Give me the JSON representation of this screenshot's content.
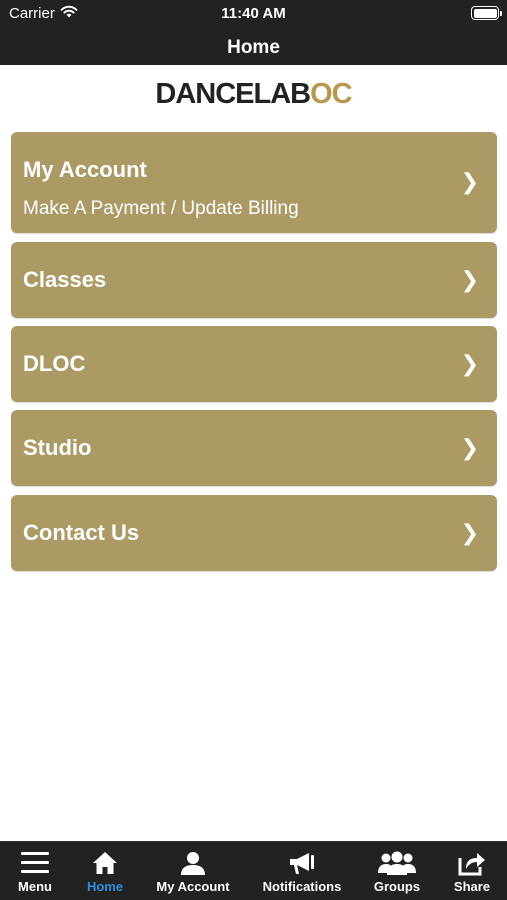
{
  "status_bar": {
    "carrier": "Carrier",
    "time": "11:40 AM"
  },
  "nav": {
    "title": "Home"
  },
  "logo": {
    "part1": "DANCELAB",
    "part2": "OC",
    "colors": {
      "dark": "#222222",
      "gold": "#b8984e"
    }
  },
  "menu": {
    "items": [
      {
        "label": "My Account",
        "sub": "Make A Payment / Update Billing",
        "chevron": "❯"
      },
      {
        "label": "Classes",
        "chevron": "❯"
      },
      {
        "label": "DLOC",
        "chevron": "❯"
      },
      {
        "label": "Studio",
        "chevron": "❯"
      },
      {
        "label": "Contact Us",
        "chevron": "❯"
      }
    ],
    "color": "#ac9a64"
  },
  "tab_bar": {
    "tabs": [
      {
        "label": "Menu",
        "icon": "hamburger-icon"
      },
      {
        "label": "Home",
        "icon": "home-icon",
        "active": true
      },
      {
        "label": "My Account",
        "icon": "user-icon"
      },
      {
        "label": "Notifications",
        "icon": "megaphone-icon"
      },
      {
        "label": "Groups",
        "icon": "group-icon"
      },
      {
        "label": "Share",
        "icon": "share-icon"
      }
    ],
    "active_color": "#2f8fe0"
  }
}
